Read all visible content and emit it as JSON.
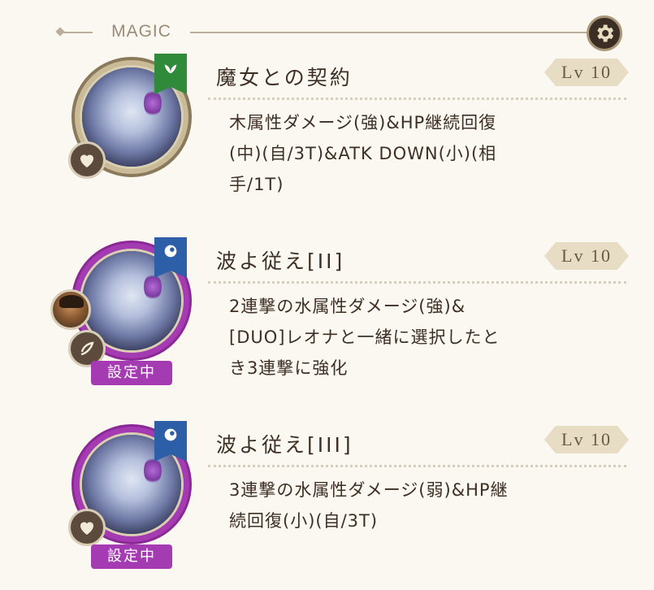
{
  "header": {
    "title": "MAGIC",
    "settings_icon": "gear-icon"
  },
  "colors": {
    "accent": "#a43bb3",
    "wood": "#2f8a3a",
    "water": "#2c5fa8",
    "badge_bg": "#e7dcc4"
  },
  "skills": [
    {
      "name": "魔女との契約",
      "level": "Lv 10",
      "attribute_icon": "leaf-icon",
      "description": [
        "木属性ダメージ(強)&HP継続回復",
        "(中)(自/3T)&ATK DOWN(小)(相",
        "手/1T)"
      ],
      "selected": false,
      "badge_icon": "heart-icon"
    },
    {
      "name": "波よ従え[II]",
      "level": "Lv 10",
      "attribute_icon": "water-drop-icon",
      "description": [
        "2連撃の水属性ダメージ(強)&",
        "[DUO]レオナと一緒に選択したと",
        "き3連撃に強化"
      ],
      "selected": true,
      "selected_label": "設定中",
      "badge_icon": "leaf-swirl-icon"
    },
    {
      "name": "波よ従え[III]",
      "level": "Lv 10",
      "attribute_icon": "water-drop-icon",
      "description": [
        "3連撃の水属性ダメージ(弱)&HP継",
        "続回復(小)(自/3T)"
      ],
      "selected": true,
      "selected_label": "設定中",
      "badge_icon": "heart-icon"
    }
  ]
}
